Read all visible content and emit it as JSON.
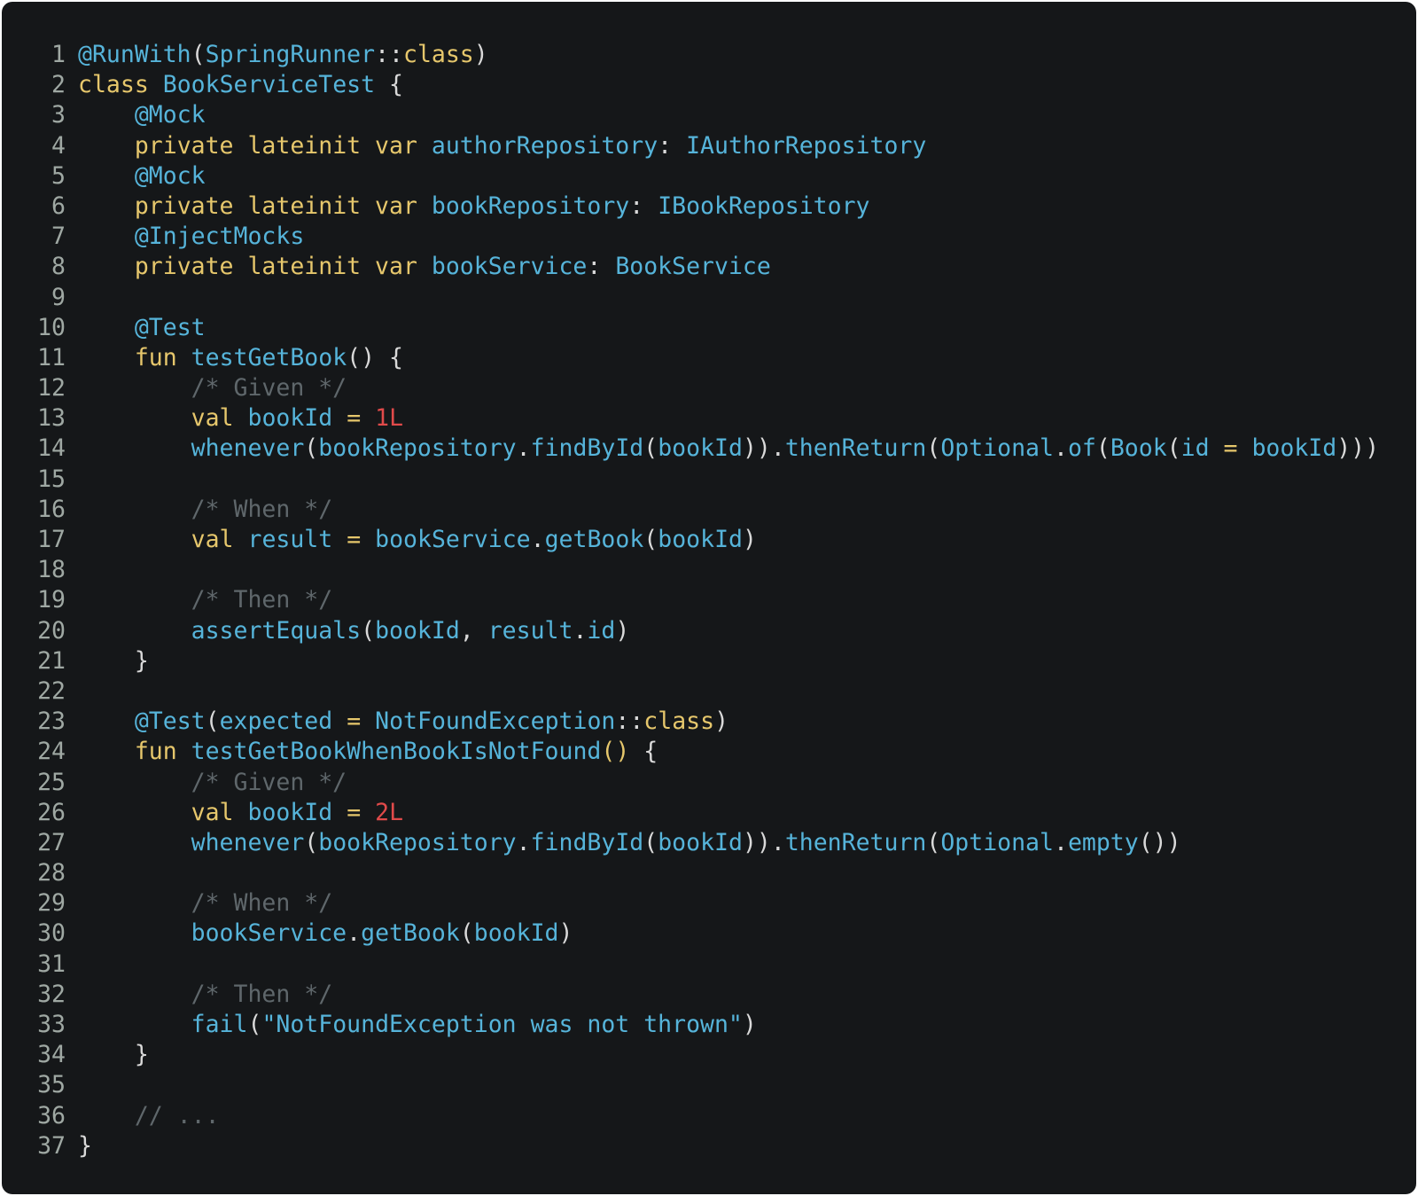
{
  "editor": {
    "language": "Kotlin",
    "colors": {
      "background": "#151719",
      "keyword": "#e6c76c",
      "identifier": "#56b4da",
      "punctuation": "#d9d9d9",
      "comment": "#5f676b",
      "number": "#e04a4a",
      "line_number": "#9fa8a3"
    },
    "lines": [
      {
        "n": "1",
        "tokens": [
          [
            "id",
            "@RunWith"
          ],
          [
            "pn",
            "("
          ],
          [
            "id",
            "SpringRunner"
          ],
          [
            "pn",
            "::"
          ],
          [
            "kw",
            "class"
          ],
          [
            "pn",
            ")"
          ]
        ]
      },
      {
        "n": "2",
        "tokens": [
          [
            "kw",
            "class"
          ],
          [
            "pn",
            " "
          ],
          [
            "id",
            "BookServiceTest"
          ],
          [
            "pn",
            " {"
          ]
        ]
      },
      {
        "n": "3",
        "tokens": [
          [
            "pn",
            "    "
          ],
          [
            "id",
            "@Mock"
          ]
        ]
      },
      {
        "n": "4",
        "tokens": [
          [
            "pn",
            "    "
          ],
          [
            "kw",
            "private lateinit var"
          ],
          [
            "pn",
            " "
          ],
          [
            "id",
            "authorRepository"
          ],
          [
            "pn",
            ": "
          ],
          [
            "id",
            "IAuthorRepository"
          ]
        ]
      },
      {
        "n": "5",
        "tokens": [
          [
            "pn",
            "    "
          ],
          [
            "id",
            "@Mock"
          ]
        ]
      },
      {
        "n": "6",
        "tokens": [
          [
            "pn",
            "    "
          ],
          [
            "kw",
            "private lateinit var"
          ],
          [
            "pn",
            " "
          ],
          [
            "id",
            "bookRepository"
          ],
          [
            "pn",
            ": "
          ],
          [
            "id",
            "IBookRepository"
          ]
        ]
      },
      {
        "n": "7",
        "tokens": [
          [
            "pn",
            "    "
          ],
          [
            "id",
            "@InjectMocks"
          ]
        ]
      },
      {
        "n": "8",
        "tokens": [
          [
            "pn",
            "    "
          ],
          [
            "kw",
            "private lateinit var"
          ],
          [
            "pn",
            " "
          ],
          [
            "id",
            "bookService"
          ],
          [
            "pn",
            ": "
          ],
          [
            "id",
            "BookService"
          ]
        ]
      },
      {
        "n": "9",
        "tokens": []
      },
      {
        "n": "10",
        "tokens": [
          [
            "pn",
            "    "
          ],
          [
            "id",
            "@Test"
          ]
        ]
      },
      {
        "n": "11",
        "tokens": [
          [
            "pn",
            "    "
          ],
          [
            "kw",
            "fun"
          ],
          [
            "pn",
            " "
          ],
          [
            "id",
            "testGetBook"
          ],
          [
            "pn",
            "() {"
          ]
        ]
      },
      {
        "n": "12",
        "tokens": [
          [
            "pn",
            "        "
          ],
          [
            "cm",
            "/* Given */"
          ]
        ]
      },
      {
        "n": "13",
        "tokens": [
          [
            "pn",
            "        "
          ],
          [
            "kw",
            "val"
          ],
          [
            "pn",
            " "
          ],
          [
            "id",
            "bookId"
          ],
          [
            "pn",
            " "
          ],
          [
            "kw",
            "="
          ],
          [
            "pn",
            " "
          ],
          [
            "nm",
            "1L"
          ]
        ]
      },
      {
        "n": "14",
        "tokens": [
          [
            "pn",
            "        "
          ],
          [
            "id",
            "whenever"
          ],
          [
            "pn",
            "("
          ],
          [
            "id",
            "bookRepository"
          ],
          [
            "pn",
            "."
          ],
          [
            "id",
            "findById"
          ],
          [
            "pn",
            "("
          ],
          [
            "id",
            "bookId"
          ],
          [
            "pn",
            "))."
          ],
          [
            "id",
            "thenReturn"
          ],
          [
            "pn",
            "("
          ],
          [
            "id",
            "Optional"
          ],
          [
            "pn",
            "."
          ],
          [
            "id",
            "of"
          ],
          [
            "pn",
            "("
          ],
          [
            "id",
            "Book"
          ],
          [
            "pn",
            "("
          ],
          [
            "id",
            "id"
          ],
          [
            "pn",
            " "
          ],
          [
            "kw",
            "="
          ],
          [
            "pn",
            " "
          ],
          [
            "id",
            "bookId"
          ],
          [
            "pn",
            ")))"
          ]
        ]
      },
      {
        "n": "15",
        "tokens": []
      },
      {
        "n": "16",
        "tokens": [
          [
            "pn",
            "        "
          ],
          [
            "cm",
            "/* When */"
          ]
        ]
      },
      {
        "n": "17",
        "tokens": [
          [
            "pn",
            "        "
          ],
          [
            "kw",
            "val"
          ],
          [
            "pn",
            " "
          ],
          [
            "id",
            "result"
          ],
          [
            "pn",
            " "
          ],
          [
            "kw",
            "="
          ],
          [
            "pn",
            " "
          ],
          [
            "id",
            "bookService"
          ],
          [
            "pn",
            "."
          ],
          [
            "id",
            "getBook"
          ],
          [
            "pn",
            "("
          ],
          [
            "id",
            "bookId"
          ],
          [
            "pn",
            ")"
          ]
        ]
      },
      {
        "n": "18",
        "tokens": []
      },
      {
        "n": "19",
        "tokens": [
          [
            "pn",
            "        "
          ],
          [
            "cm",
            "/* Then */"
          ]
        ]
      },
      {
        "n": "20",
        "tokens": [
          [
            "pn",
            "        "
          ],
          [
            "id",
            "assertEquals"
          ],
          [
            "pn",
            "("
          ],
          [
            "id",
            "bookId"
          ],
          [
            "pn",
            ", "
          ],
          [
            "id",
            "result"
          ],
          [
            "pn",
            "."
          ],
          [
            "id",
            "id"
          ],
          [
            "pn",
            ")"
          ]
        ]
      },
      {
        "n": "21",
        "tokens": [
          [
            "pn",
            "    }"
          ]
        ]
      },
      {
        "n": "22",
        "tokens": []
      },
      {
        "n": "23",
        "tokens": [
          [
            "pn",
            "    "
          ],
          [
            "id",
            "@Test"
          ],
          [
            "pn",
            "("
          ],
          [
            "id",
            "expected"
          ],
          [
            "pn",
            " "
          ],
          [
            "kw",
            "="
          ],
          [
            "pn",
            " "
          ],
          [
            "id",
            "NotFoundException"
          ],
          [
            "pn",
            "::"
          ],
          [
            "kw",
            "class"
          ],
          [
            "pn",
            ")"
          ]
        ]
      },
      {
        "n": "24",
        "tokens": [
          [
            "pn",
            "    "
          ],
          [
            "kw",
            "fun"
          ],
          [
            "pn",
            " "
          ],
          [
            "id",
            "testGetBookWhenBookIsNotFound"
          ],
          [
            "kw",
            "()"
          ],
          [
            "pn",
            " {"
          ]
        ]
      },
      {
        "n": "25",
        "tokens": [
          [
            "pn",
            "        "
          ],
          [
            "cm",
            "/* Given */"
          ]
        ]
      },
      {
        "n": "26",
        "tokens": [
          [
            "pn",
            "        "
          ],
          [
            "kw",
            "val"
          ],
          [
            "pn",
            " "
          ],
          [
            "id",
            "bookId"
          ],
          [
            "pn",
            " "
          ],
          [
            "kw",
            "="
          ],
          [
            "pn",
            " "
          ],
          [
            "nm",
            "2L"
          ]
        ]
      },
      {
        "n": "27",
        "tokens": [
          [
            "pn",
            "        "
          ],
          [
            "id",
            "whenever"
          ],
          [
            "pn",
            "("
          ],
          [
            "id",
            "bookRepository"
          ],
          [
            "pn",
            "."
          ],
          [
            "id",
            "findById"
          ],
          [
            "pn",
            "("
          ],
          [
            "id",
            "bookId"
          ],
          [
            "pn",
            "))."
          ],
          [
            "id",
            "thenReturn"
          ],
          [
            "pn",
            "("
          ],
          [
            "id",
            "Optional"
          ],
          [
            "pn",
            "."
          ],
          [
            "id",
            "empty"
          ],
          [
            "pn",
            "())"
          ]
        ]
      },
      {
        "n": "28",
        "tokens": []
      },
      {
        "n": "29",
        "tokens": [
          [
            "pn",
            "        "
          ],
          [
            "cm",
            "/* When */"
          ]
        ]
      },
      {
        "n": "30",
        "tokens": [
          [
            "pn",
            "        "
          ],
          [
            "id",
            "bookService"
          ],
          [
            "pn",
            "."
          ],
          [
            "id",
            "getBook"
          ],
          [
            "pn",
            "("
          ],
          [
            "id",
            "bookId"
          ],
          [
            "pn",
            ")"
          ]
        ]
      },
      {
        "n": "31",
        "tokens": []
      },
      {
        "n": "32",
        "tokens": [
          [
            "pn",
            "        "
          ],
          [
            "cm",
            "/* Then */"
          ]
        ]
      },
      {
        "n": "33",
        "tokens": [
          [
            "pn",
            "        "
          ],
          [
            "id",
            "fail"
          ],
          [
            "pn",
            "("
          ],
          [
            "st",
            "\"NotFoundException was not thrown\""
          ],
          [
            "pn",
            ")"
          ]
        ]
      },
      {
        "n": "34",
        "tokens": [
          [
            "pn",
            "    }"
          ]
        ]
      },
      {
        "n": "35",
        "tokens": []
      },
      {
        "n": "36",
        "tokens": [
          [
            "pn",
            "    "
          ],
          [
            "cm",
            "// ..."
          ]
        ]
      },
      {
        "n": "37",
        "tokens": [
          [
            "pn",
            "}"
          ]
        ]
      }
    ]
  }
}
